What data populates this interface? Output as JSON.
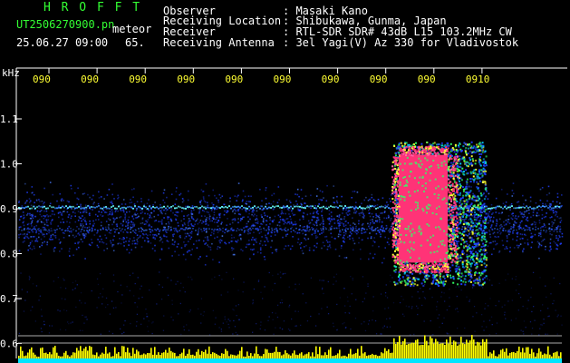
{
  "header": {
    "program_name": "H R O F F T",
    "file_name": "UT2506270900.pn",
    "mode": "meteor",
    "datetime": "25.06.27 09:00",
    "count": "65.",
    "fields": [
      {
        "label": "Observer",
        "value": ": Masaki Kano"
      },
      {
        "label": "Receiving Location",
        "value": ": Shibukawa, Gunma, Japan"
      },
      {
        "label": "Receiver",
        "value": ": RTL-SDR SDR# 43dB L15 103.2MHz CW"
      },
      {
        "label": "Receiving Antenna",
        "value": ": 3el Yagi(V) Az 330 for Vladivostok"
      }
    ]
  },
  "y_axis": {
    "unit": "kHz",
    "ticks": [
      "1.1",
      "1.0",
      "0.9",
      "0.8",
      "0.7",
      "0.6"
    ]
  },
  "x_axis": {
    "ticks": [
      "090",
      "090",
      "090",
      "090",
      "090",
      "090",
      "090",
      "090",
      "090",
      "0910"
    ]
  },
  "colors": {
    "background": "#000000",
    "header_green": "#33ff33",
    "header_white": "#ffffff",
    "tick_yellow": "#ffff33",
    "axis_white": "#ffffff",
    "noise_blue": "#2040ff",
    "carrier_cyan": "#66ffff",
    "echo_core": "#ff3377",
    "echo_mid": "#33ff66",
    "echo_edge": "#ffff33",
    "level_yellow": "#ffff00",
    "level_baseline": "#00e5ff"
  },
  "spectrogram": {
    "noise_band_khz": [
      0.77,
      0.97
    ],
    "carrier_khz": 0.905,
    "echo": {
      "time_start": 0.69,
      "time_end": 0.86,
      "freq_low_khz": 0.73,
      "freq_high_khz": 1.05,
      "core_time_start": 0.7,
      "core_time_end": 0.79,
      "core_freq_low_khz": 0.78,
      "core_freq_high_khz": 1.02
    }
  }
}
